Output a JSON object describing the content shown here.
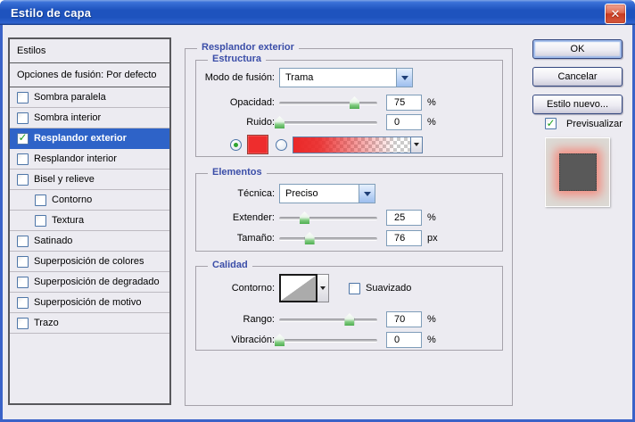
{
  "window": {
    "title": "Estilo de capa",
    "close_glyph": "✕"
  },
  "sidebar": {
    "header": "Estilos",
    "blend_options": "Opciones de fusión: Por defecto",
    "items": [
      {
        "label": "Sombra paralela",
        "checked": false,
        "selected": false,
        "indent": false
      },
      {
        "label": "Sombra interior",
        "checked": false,
        "selected": false,
        "indent": false
      },
      {
        "label": "Resplandor exterior",
        "checked": true,
        "selected": true,
        "indent": false
      },
      {
        "label": "Resplandor interior",
        "checked": false,
        "selected": false,
        "indent": false
      },
      {
        "label": "Bisel y relieve",
        "checked": false,
        "selected": false,
        "indent": false
      },
      {
        "label": "Contorno",
        "checked": false,
        "selected": false,
        "indent": true
      },
      {
        "label": "Textura",
        "checked": false,
        "selected": false,
        "indent": true
      },
      {
        "label": "Satinado",
        "checked": false,
        "selected": false,
        "indent": false
      },
      {
        "label": "Superposición de colores",
        "checked": false,
        "selected": false,
        "indent": false
      },
      {
        "label": "Superposición de degradado",
        "checked": false,
        "selected": false,
        "indent": false
      },
      {
        "label": "Superposición de motivo",
        "checked": false,
        "selected": false,
        "indent": false
      },
      {
        "label": "Trazo",
        "checked": false,
        "selected": false,
        "indent": false
      }
    ]
  },
  "panel": {
    "title": "Resplandor exterior",
    "estructura": {
      "title": "Estructura",
      "blend_mode": {
        "label": "Modo de fusión:",
        "value": "Trama"
      },
      "opacity": {
        "label": "Opacidad:",
        "value": "75",
        "unit": "%",
        "pct": 75
      },
      "noise": {
        "label": "Ruido:",
        "value": "0",
        "unit": "%",
        "pct": 0
      }
    },
    "elementos": {
      "title": "Elementos",
      "technique": {
        "label": "Técnica:",
        "value": "Preciso"
      },
      "spread": {
        "label": "Extender:",
        "value": "25",
        "unit": "%",
        "pct": 25
      },
      "size": {
        "label": "Tamaño:",
        "value": "76",
        "unit": "px",
        "pct": 30
      }
    },
    "calidad": {
      "title": "Calidad",
      "contour": {
        "label": "Contorno:"
      },
      "antialias_label": "Suavizado",
      "range": {
        "label": "Rango:",
        "value": "70",
        "unit": "%",
        "pct": 70
      },
      "jitter": {
        "label": "Vibración:",
        "value": "0",
        "unit": "%",
        "pct": 0
      }
    }
  },
  "actions": {
    "ok": "OK",
    "cancel": "Cancelar",
    "new_style": "Estilo nuevo...",
    "preview": "Previsualizar"
  },
  "colors": {
    "glow_red": "#EE2D2D",
    "selection_blue": "#2E63C8",
    "heading_blue": "#3B4EA8",
    "titlebar_blue": "#1E53BE"
  }
}
